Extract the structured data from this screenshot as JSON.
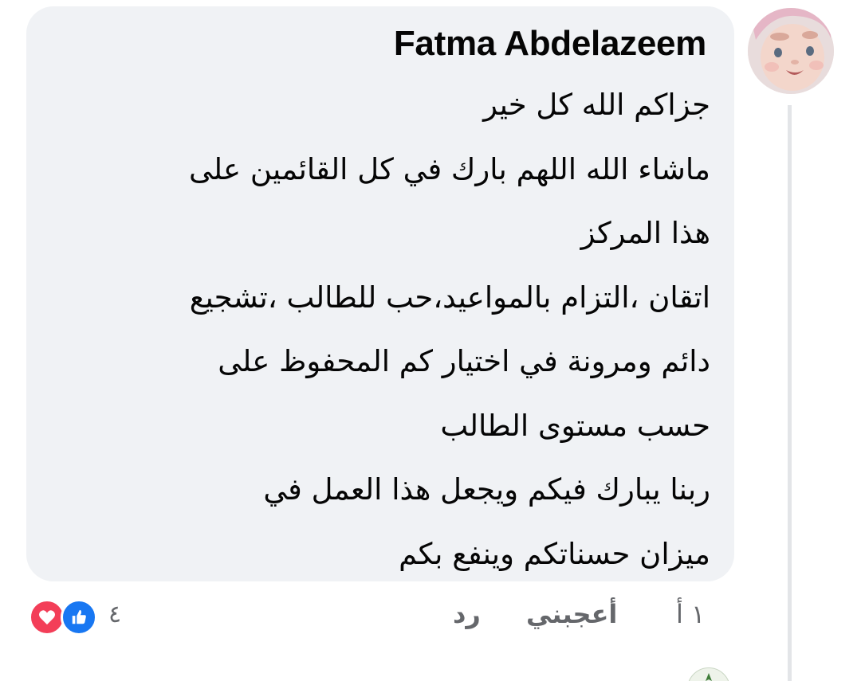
{
  "comment": {
    "author": "Fatma Abdelazeem",
    "lines": [
      "جزاكم الله كل خير",
      "ماشاء الله اللهم بارك في كل القائمين على",
      "هذا المركز",
      "اتقان ،التزام بالمواعيد،حب للطالب ،تشجيع",
      "دائم ومرونة في اختيار كم المحفوظ على",
      "حسب مستوى الطالب",
      "ربنا يبارك فيكم ويجعل هذا العمل في",
      "ميزان حسناتكم وينفع بكم"
    ]
  },
  "actions": {
    "time": "١ أ",
    "like_label": "أعجبني",
    "reply_label": "رد"
  },
  "reactions": {
    "count": "٤",
    "icons": [
      "love-icon",
      "like-icon"
    ],
    "colors": {
      "love": "#f33e58",
      "like": "#1877f2"
    }
  },
  "avatar": {
    "icon": "baby-profile-photo"
  },
  "next_comment": {
    "author_partial": ""
  },
  "colors": {
    "bubble": "#f0f2f5",
    "text": "#050505",
    "secondary": "#65676b",
    "thread_line": "#e3e5e8"
  }
}
